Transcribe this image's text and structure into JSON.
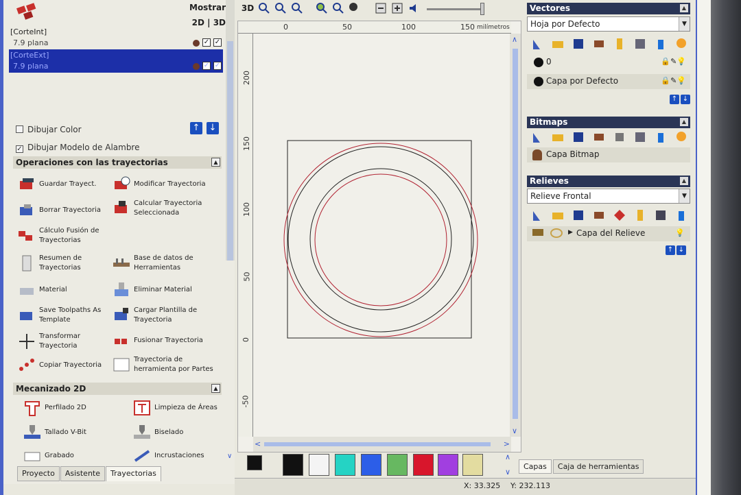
{
  "left_panel": {
    "mostrar_label": "Mostrar",
    "mode_label": "2D | 3D",
    "toolpaths": [
      {
        "name": "[CorteInt]",
        "sub": "7.9 plana"
      },
      {
        "name": "[CorteExt]",
        "sub": "7.9 plana"
      }
    ],
    "draw_color_label": "Dibujar Color",
    "draw_wire_label": "Dibujar Modelo de Alambre",
    "ops_title": "Operaciones con las trayectorias",
    "ops": [
      {
        "label": "Guardar Trayect."
      },
      {
        "label": "Modificar Trayectoria"
      },
      {
        "label": "Borrar Trayectoria"
      },
      {
        "label": "Calcular Trayectoria Seleccionada"
      },
      {
        "label": "Cálculo Fusión de Trayectorias"
      },
      {
        "label": "Resumen de Trayectorias"
      },
      {
        "label": "Base de datos de Herramientas"
      },
      {
        "label": "Material"
      },
      {
        "label": "Eliminar Material"
      },
      {
        "label": "Save Toolpaths As Template"
      },
      {
        "label": "Cargar Plantilla de Trayectoria"
      },
      {
        "label": "Transformar Trayectoria"
      },
      {
        "label": "Fusionar Trayectoria"
      },
      {
        "label": "Copiar Trayectoria"
      },
      {
        "label": "Trayectoria de herramienta por Partes"
      }
    ],
    "mec_title": "Mecanizado 2D",
    "mec": [
      {
        "label": "Perfilado 2D"
      },
      {
        "label": "Limpieza de Áreas"
      },
      {
        "label": "Tallado V-Bit"
      },
      {
        "label": "Biselado"
      },
      {
        "label": "Grabado"
      },
      {
        "label": "Incrustaciones"
      }
    ],
    "tabs": [
      "Proyecto",
      "Asistente",
      "Trayectorias"
    ]
  },
  "toolbar": {
    "label_3d": "3D"
  },
  "ruler": {
    "h_ticks": [
      "0",
      "50",
      "100",
      "150"
    ],
    "unit": "milímetros",
    "v_ticks": [
      "200",
      "150",
      "100",
      "50",
      "0",
      "-50"
    ]
  },
  "palette": {
    "colors": [
      "#111111",
      "#f4f4f4",
      "#25d3c4",
      "#2c5ee8",
      "#67b861",
      "#d8162c",
      "#a13fe0",
      "#e3dca0"
    ]
  },
  "right_panel": {
    "vectores_title": "Vectores",
    "vectores_sheet": "Hoja por Defecto",
    "vect_layer0": "0",
    "vect_layer_default": "Capa por Defecto",
    "bitmaps_title": "Bitmaps",
    "bitmap_layer": "Capa Bitmap",
    "relieves_title": "Relieves",
    "relieves_select": "Relieve Frontal",
    "relief_layer": "Capa del Relieve",
    "tabs": [
      "Capas",
      "Caja de herramientas"
    ]
  },
  "status": {
    "x": "X: 33.325",
    "y": "Y: 232.113"
  }
}
